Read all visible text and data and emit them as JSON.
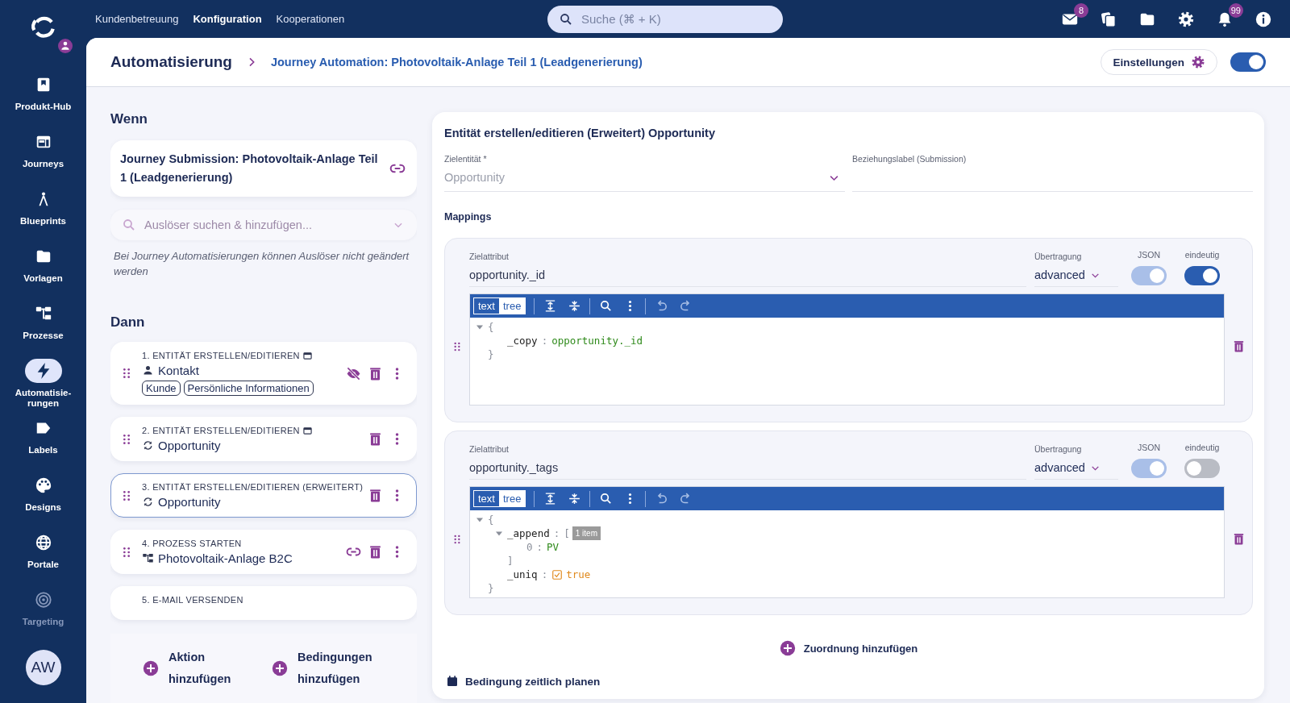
{
  "nav": {
    "items": [
      {
        "label": "Kundenbetreuung",
        "selected": false
      },
      {
        "label": "Konfiguration",
        "selected": true
      },
      {
        "label": "Kooperationen",
        "selected": false
      }
    ],
    "search": {
      "placeholder": "Suche (⌘ + K)"
    },
    "mail_badge": "8",
    "bell_badge": "99"
  },
  "sidebar": {
    "items": [
      {
        "label": "Produkt-Hub",
        "selected": false,
        "disabled": false
      },
      {
        "label": "Journeys",
        "selected": false,
        "disabled": false
      },
      {
        "label": "Blueprints",
        "selected": false,
        "disabled": false
      },
      {
        "label": "Vorlagen",
        "selected": false,
        "disabled": false
      },
      {
        "label": "Prozesse",
        "selected": false,
        "disabled": false
      },
      {
        "label": "Automatisie-rungen",
        "selected": true,
        "disabled": false
      },
      {
        "label": "Labels",
        "selected": false,
        "disabled": false
      },
      {
        "label": "Designs",
        "selected": false,
        "disabled": false
      },
      {
        "label": "Portale",
        "selected": false,
        "disabled": false
      },
      {
        "label": "Targeting",
        "selected": false,
        "disabled": true
      }
    ],
    "avatar": "AW"
  },
  "header": {
    "title": "Automatisierung",
    "breadcrumb": "Journey Automation: Photovoltaik-Anlage Teil 1 (Leadgenerierung)",
    "settings_button": "Einstellungen",
    "active": true
  },
  "when": {
    "heading": "Wenn",
    "trigger": "Journey Submission: Photovoltaik-Anlage Teil 1 (Leadgenerierung)",
    "search": {
      "placeholder": "Auslöser suchen & hinzufügen...",
      "disabled": true
    },
    "note": "Bei Journey Automatisierungen können Auslöser nicht geändert werden"
  },
  "then": {
    "heading": "Dann",
    "actions": [
      {
        "label": "1. ENTITÄT ERSTELLEN/EDITIEREN",
        "name": "Kontakt",
        "tags": [
          "Kunde",
          "Persönliche Informationen"
        ],
        "selected": false
      },
      {
        "label": "2. ENTITÄT ERSTELLEN/EDITIEREN",
        "name": "Opportunity",
        "selected": false
      },
      {
        "label": "3. ENTITÄT ERSTELLEN/EDITIEREN (ERWEITERT)",
        "name": "Opportunity",
        "selected": true
      },
      {
        "label": "4. PROZESS STARTEN",
        "name": "Photovoltaik-Anlage B2C",
        "selected": false
      },
      {
        "label": "5. E-MAIL VERSENDEN",
        "selected": false
      }
    ],
    "add_action": "Aktion hinzufügen",
    "add_condition": "Bedingungen hinzufügen"
  },
  "detail": {
    "title": "Entität erstellen/editieren (Erweitert) Opportunity",
    "target_entity": {
      "label": "Zielentität *",
      "value": "Opportunity",
      "disabled": true
    },
    "relation_label": {
      "label": "Beziehungslabel (Submission)"
    },
    "mappings_heading": "Mappings",
    "mappings": [
      {
        "attribute_label": "Zielattribut",
        "attribute": "opportunity._id",
        "transfer_label": "Übertragung",
        "transfer": "advanced",
        "json_label": "JSON",
        "json": {
          "on": true,
          "disabled": true
        },
        "unique_label": "eindeutig",
        "unique": true,
        "modes": [
          {
            "label": "text",
            "selected": true
          },
          {
            "label": "tree",
            "selected": false
          }
        ],
        "document": {
          "kind": "object",
          "open": "{",
          "close": "}",
          "expanded": true,
          "children": [
            {
              "key": "_copy",
              "sep": ":",
              "kind": "string",
              "value": "opportunity._id"
            }
          ]
        }
      },
      {
        "attribute_label": "Zielattribut",
        "attribute": "opportunity._tags",
        "transfer_label": "Übertragung",
        "transfer": "advanced",
        "json_label": "JSON",
        "json": {
          "on": true,
          "disabled": true
        },
        "unique_label": "eindeutig",
        "unique": false,
        "modes": [
          {
            "label": "text",
            "selected": true
          },
          {
            "label": "tree",
            "selected": false
          }
        ],
        "document": {
          "kind": "object",
          "open": "{",
          "close": "}",
          "expanded": true,
          "children": [
            {
              "key": "_append",
              "sep": ":",
              "kind": "array",
              "open": "[",
              "count": "1 item",
              "close": "]",
              "expanded": true,
              "children": [
                {
                  "key": "0",
                  "sep": ":",
                  "kind": "string",
                  "value": "PV"
                }
              ]
            },
            {
              "key": "_uniq",
              "sep": ":",
              "kind": "boolean",
              "value": "true",
              "checked": true
            }
          ]
        }
      }
    ],
    "add_mapping": "Zuordnung hinzufügen",
    "schedule": "Bedingung zeitlich planen"
  }
}
